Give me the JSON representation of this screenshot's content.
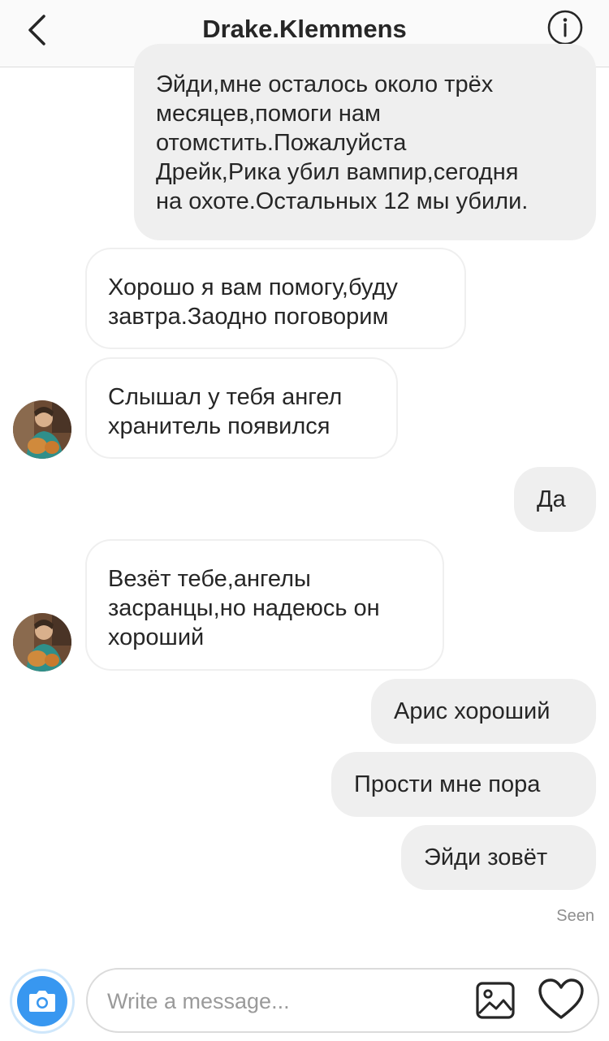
{
  "header": {
    "title": "Drake.Klemmens",
    "back_icon": "chevron-left-icon",
    "info_icon": "info-icon"
  },
  "messages": [
    {
      "direction": "outgoing",
      "lines": [
        "Эйди,мне осталось около трёх",
        "месяцев,помоги нам",
        "отомстить.Пожалуйста",
        "Дрейк,Рика убил вампир,сегодня",
        "на охоте.Остальных 12 мы убили."
      ]
    },
    {
      "direction": "incoming",
      "lines": [
        "Хорошо я вам помогу,буду",
        "завтра.Заодно поговорим"
      ]
    },
    {
      "direction": "incoming",
      "lines": [
        "Слышал у тебя ангел",
        "хранитель появился"
      ]
    },
    {
      "direction": "outgoing",
      "lines": [
        "Да"
      ]
    },
    {
      "direction": "incoming",
      "lines": [
        "Везёт тебе,ангелы",
        "засранцы,но надеюсь он",
        "хороший"
      ]
    },
    {
      "direction": "outgoing",
      "lines": [
        "Арис хороший"
      ]
    },
    {
      "direction": "outgoing",
      "lines": [
        "Прости мне пора"
      ]
    },
    {
      "direction": "outgoing",
      "lines": [
        "Эйди зовёт"
      ]
    }
  ],
  "status": {
    "seen": "Seen"
  },
  "composer": {
    "placeholder": "Write a message...",
    "camera_icon": "camera-icon",
    "gallery_icon": "image-icon",
    "like_icon": "heart-icon"
  },
  "colors": {
    "outgoing_bubble": "#efefef",
    "incoming_border": "#efefef",
    "camera": "#3897f0"
  }
}
